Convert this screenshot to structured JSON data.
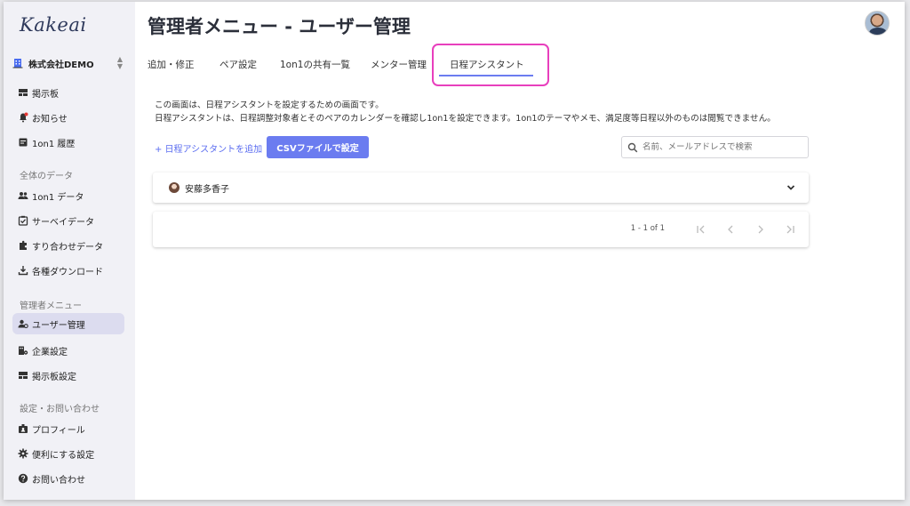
{
  "app": {
    "logo": "Kakeai"
  },
  "company": {
    "name": "株式会社DEMO"
  },
  "sidebar": {
    "top_items": [
      {
        "label": "掲示板",
        "icon": "board-icon"
      },
      {
        "label": "お知らせ",
        "icon": "bell-icon"
      },
      {
        "label": "1on1 履歴",
        "icon": "history-icon"
      }
    ],
    "section_data": "全体のデータ",
    "data_items": [
      {
        "label": "1on1 データ",
        "icon": "people-icon"
      },
      {
        "label": "サーベイデータ",
        "icon": "survey-icon"
      },
      {
        "label": "すり合わせデータ",
        "icon": "puzzle-icon"
      },
      {
        "label": "各種ダウンロード",
        "icon": "download-icon"
      }
    ],
    "section_admin": "管理者メニュー",
    "admin_items": [
      {
        "label": "ユーザー管理",
        "icon": "user-manage-icon",
        "active": true
      },
      {
        "label": "企業設定",
        "icon": "company-settings-icon"
      },
      {
        "label": "掲示板設定",
        "icon": "board-settings-icon"
      }
    ],
    "section_settings": "設定・お問い合わせ",
    "settings_items": [
      {
        "label": "プロフィール",
        "icon": "profile-icon"
      },
      {
        "label": "便利にする設定",
        "icon": "gear-icon"
      },
      {
        "label": "お問い合わせ",
        "icon": "help-icon"
      }
    ]
  },
  "header": {
    "title": "管理者メニュー - ユーザー管理"
  },
  "tabs": [
    {
      "label": "追加・修正"
    },
    {
      "label": "ペア設定"
    },
    {
      "label": "1on1の共有一覧"
    },
    {
      "label": "メンター管理"
    },
    {
      "label": "日程アシスタント",
      "active": true
    }
  ],
  "main": {
    "description_line1": "この画面は、日程アシスタントを設定するための画面です。",
    "description_line2": "日程アシスタントは、日程調整対象者とそのペアのカレンダーを確認し1on1を設定できます。1on1のテーマやメモ、満足度等日程以外のものは閲覧できません。",
    "add_link": "+ 日程アシスタントを追加",
    "csv_button": "CSVファイルで設定",
    "search_placeholder": "名前、メールアドレスで検索",
    "users": [
      {
        "name": "安藤多香子"
      }
    ],
    "pagination": {
      "count_text": "1 - 1 of 1"
    }
  },
  "colors": {
    "accent": "#6b7cf0",
    "highlight": "#e83fbd",
    "sidebar_bg": "#f1f1f6",
    "notification_dot": "#e53935"
  }
}
